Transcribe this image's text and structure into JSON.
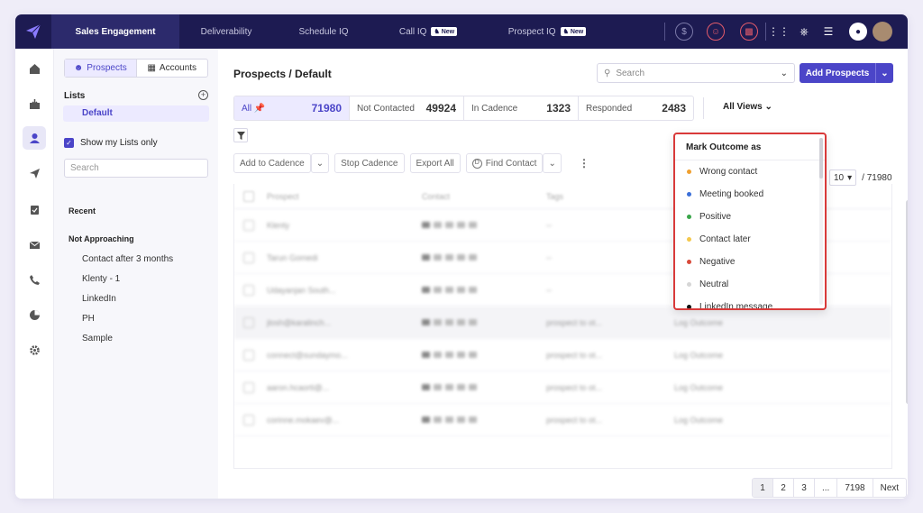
{
  "topnav": {
    "tabs": [
      {
        "label": "Sales Engagement",
        "new": ""
      },
      {
        "label": "Deliverability",
        "new": ""
      },
      {
        "label": "Schedule IQ",
        "new": ""
      },
      {
        "label": "Call IQ",
        "new": "New"
      },
      {
        "label": "Prospect IQ",
        "new": "New"
      }
    ]
  },
  "listpanel": {
    "seg_prospects": "Prospects",
    "seg_accounts": "Accounts",
    "lists_title": "Lists",
    "default_list": "Default",
    "show_my_lists": "Show my Lists only",
    "search_placeholder": "Search",
    "recent_label": "Recent",
    "group_label": "Not Approaching",
    "items": [
      "Contact after 3 months",
      "Klenty - 1",
      "LinkedIn",
      "PH",
      "Sample"
    ]
  },
  "main": {
    "breadcrumb": "Prospects / Default",
    "search_placeholder": "Search",
    "add_prospects": "Add Prospects",
    "stats": [
      {
        "label": "All",
        "value": "71980"
      },
      {
        "label": "Not Contacted",
        "value": "49924"
      },
      {
        "label": "In Cadence",
        "value": "1323"
      },
      {
        "label": "Responded",
        "value": "2483"
      }
    ],
    "all_views": "All Views",
    "toolbar": {
      "add_to_cadence": "Add to Cadence",
      "stop_cadence": "Stop Cadence",
      "export_all": "Export All",
      "find_contact": "Find Contact"
    },
    "page_size": "10",
    "total": "/ 71980",
    "table": {
      "headers": [
        "Prospect",
        "Contact",
        "Tags"
      ],
      "rows": [
        {
          "name": "Klenty",
          "tags": "--",
          "outcome": ""
        },
        {
          "name": "Tarun Gomedi",
          "tags": "--",
          "outcome": ""
        },
        {
          "name": "Udayanjan South...",
          "tags": "--",
          "outcome": ""
        },
        {
          "name": "jlosh@karalinch...",
          "tags": "prospect to ot...",
          "outcome": "Log Outcome"
        },
        {
          "name": "connect@sundaymo...",
          "tags": "prospect to ot...",
          "outcome": "Log Outcome"
        },
        {
          "name": "aaron.hcaorti@...",
          "tags": "prospect to ot...",
          "outcome": "Log Outcome"
        },
        {
          "name": "corinne.mokaev@...",
          "tags": "prospect to ot...",
          "outcome": "Log Outcome"
        }
      ]
    },
    "pagination": [
      "1",
      "2",
      "3",
      "...",
      "7198",
      "Next"
    ]
  },
  "dropdown": {
    "title": "Mark Outcome as",
    "items": [
      {
        "label": "Wrong contact",
        "color": "#f0a030"
      },
      {
        "label": "Meeting booked",
        "color": "#3b6fd8"
      },
      {
        "label": "Positive",
        "color": "#3aa64a"
      },
      {
        "label": "Contact later",
        "color": "#f4c84c"
      },
      {
        "label": "Negative",
        "color": "#d84a3a"
      },
      {
        "label": "Neutral",
        "color": "#d6d6d6"
      },
      {
        "label": "LinkedIn message",
        "color": "#111111"
      }
    ]
  }
}
